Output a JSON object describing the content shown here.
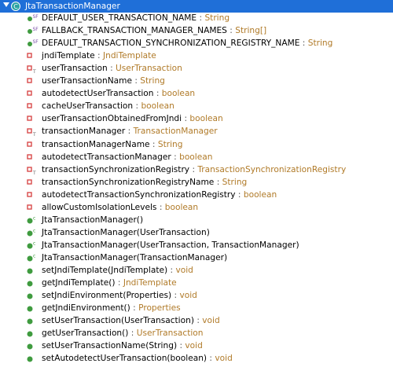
{
  "header": {
    "title": "JtaTransactionManager"
  },
  "rows": [
    {
      "kind": "const",
      "name": "DEFAULT_USER_TRANSACTION_NAME",
      "type": "String"
    },
    {
      "kind": "const",
      "name": "FALLBACK_TRANSACTION_MANAGER_NAMES",
      "type": "String[]"
    },
    {
      "kind": "const",
      "name": "DEFAULT_TRANSACTION_SYNCHRONIZATION_REGISTRY_NAME",
      "type": "String"
    },
    {
      "kind": "field",
      "name": "jndiTemplate",
      "type": "JndiTemplate"
    },
    {
      "kind": "field-t",
      "name": "userTransaction",
      "type": "UserTransaction"
    },
    {
      "kind": "field",
      "name": "userTransactionName",
      "type": "String"
    },
    {
      "kind": "field",
      "name": "autodetectUserTransaction",
      "type": "boolean"
    },
    {
      "kind": "field",
      "name": "cacheUserTransaction",
      "type": "boolean"
    },
    {
      "kind": "field",
      "name": "userTransactionObtainedFromJndi",
      "type": "boolean"
    },
    {
      "kind": "field-t",
      "name": "transactionManager",
      "type": "TransactionManager"
    },
    {
      "kind": "field",
      "name": "transactionManagerName",
      "type": "String"
    },
    {
      "kind": "field",
      "name": "autodetectTransactionManager",
      "type": "boolean"
    },
    {
      "kind": "field-t",
      "name": "transactionSynchronizationRegistry",
      "type": "TransactionSynchronizationRegistry"
    },
    {
      "kind": "field",
      "name": "transactionSynchronizationRegistryName",
      "type": "String"
    },
    {
      "kind": "field",
      "name": "autodetectTransactionSynchronizationRegistry",
      "type": "boolean"
    },
    {
      "kind": "field",
      "name": "allowCustomIsolationLevels",
      "type": "boolean"
    },
    {
      "kind": "ctor",
      "name": "JtaTransactionManager()",
      "type": ""
    },
    {
      "kind": "ctor",
      "name": "JtaTransactionManager(UserTransaction)",
      "type": ""
    },
    {
      "kind": "ctor",
      "name": "JtaTransactionManager(UserTransaction, TransactionManager)",
      "type": ""
    },
    {
      "kind": "ctor",
      "name": "JtaTransactionManager(TransactionManager)",
      "type": ""
    },
    {
      "kind": "method",
      "name": "setJndiTemplate(JndiTemplate)",
      "type": "void"
    },
    {
      "kind": "method",
      "name": "getJndiTemplate()",
      "type": "JndiTemplate"
    },
    {
      "kind": "method",
      "name": "setJndiEnvironment(Properties)",
      "type": "void"
    },
    {
      "kind": "method",
      "name": "getJndiEnvironment()",
      "type": "Properties"
    },
    {
      "kind": "method",
      "name": "setUserTransaction(UserTransaction)",
      "type": "void"
    },
    {
      "kind": "method",
      "name": "getUserTransaction()",
      "type": "UserTransaction"
    },
    {
      "kind": "method",
      "name": "setUserTransactionName(String)",
      "type": "void"
    },
    {
      "kind": "method",
      "name": "setAutodetectUserTransaction(boolean)",
      "type": "void"
    }
  ],
  "colors": {
    "selection": "#1f6fd8",
    "type_text": "#b07a28",
    "method_green": "#3f9b3f",
    "field_red": "#d94a4a",
    "class_teal": "#2aa3a3"
  }
}
